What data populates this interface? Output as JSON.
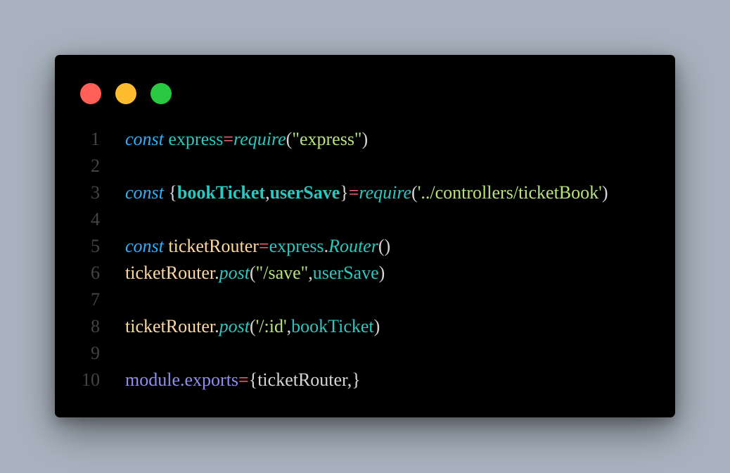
{
  "window": {
    "controls": [
      {
        "name": "close",
        "color": "#ff5f57"
      },
      {
        "name": "minimize",
        "color": "#febc2e"
      },
      {
        "name": "maximize",
        "color": "#28c840"
      }
    ]
  },
  "code": {
    "language": "javascript",
    "lines": [
      {
        "n": "1",
        "tokens": [
          {
            "t": "const",
            "c": "kw"
          },
          {
            "t": " ",
            "c": "plain"
          },
          {
            "t": "express",
            "c": "var"
          },
          {
            "t": "=",
            "c": "op"
          },
          {
            "t": "require",
            "c": "fn"
          },
          {
            "t": "(",
            "c": "pun"
          },
          {
            "t": "\"express\"",
            "c": "str"
          },
          {
            "t": ")",
            "c": "pun"
          }
        ]
      },
      {
        "n": "2",
        "tokens": []
      },
      {
        "n": "3",
        "tokens": [
          {
            "t": "const",
            "c": "kw"
          },
          {
            "t": " ",
            "c": "plain"
          },
          {
            "t": "{",
            "c": "brace"
          },
          {
            "t": "bookTicket",
            "c": "bold"
          },
          {
            "t": ",",
            "c": "pun"
          },
          {
            "t": "userSave",
            "c": "bold"
          },
          {
            "t": "}",
            "c": "brace"
          },
          {
            "t": "=",
            "c": "op"
          },
          {
            "t": "require",
            "c": "fn"
          },
          {
            "t": "(",
            "c": "pun"
          },
          {
            "t": "'../controllers/ticketBook'",
            "c": "str"
          },
          {
            "t": ")",
            "c": "pun"
          }
        ]
      },
      {
        "n": "4",
        "tokens": []
      },
      {
        "n": "5",
        "tokens": [
          {
            "t": "const",
            "c": "kw"
          },
          {
            "t": " ",
            "c": "plain"
          },
          {
            "t": "ticketRouter",
            "c": "obj"
          },
          {
            "t": "=",
            "c": "op"
          },
          {
            "t": "express",
            "c": "var"
          },
          {
            "t": ".",
            "c": "pun"
          },
          {
            "t": "Router",
            "c": "meth"
          },
          {
            "t": "()",
            "c": "pun"
          }
        ]
      },
      {
        "n": "6",
        "tokens": [
          {
            "t": "ticketRouter",
            "c": "obj"
          },
          {
            "t": ".",
            "c": "pun"
          },
          {
            "t": "post",
            "c": "meth"
          },
          {
            "t": "(",
            "c": "pun"
          },
          {
            "t": "\"/save\"",
            "c": "str"
          },
          {
            "t": ",",
            "c": "pun"
          },
          {
            "t": "userSave",
            "c": "var"
          },
          {
            "t": ")",
            "c": "pun"
          }
        ]
      },
      {
        "n": "7",
        "tokens": []
      },
      {
        "n": "8",
        "tokens": [
          {
            "t": "ticketRouter",
            "c": "obj"
          },
          {
            "t": ".",
            "c": "pun"
          },
          {
            "t": "post",
            "c": "meth"
          },
          {
            "t": "(",
            "c": "pun"
          },
          {
            "t": "'/:id'",
            "c": "str"
          },
          {
            "t": ",",
            "c": "pun"
          },
          {
            "t": "bookTicket",
            "c": "var"
          },
          {
            "t": ")",
            "c": "pun"
          }
        ]
      },
      {
        "n": "9",
        "tokens": []
      },
      {
        "n": "10",
        "tokens": [
          {
            "t": "module",
            "c": "mod"
          },
          {
            "t": ".",
            "c": "mod"
          },
          {
            "t": "exports",
            "c": "mod"
          },
          {
            "t": "=",
            "c": "op"
          },
          {
            "t": "{",
            "c": "brace"
          },
          {
            "t": "ticketRouter",
            "c": "plain"
          },
          {
            "t": ",",
            "c": "pun"
          },
          {
            "t": "}",
            "c": "brace"
          }
        ]
      }
    ]
  }
}
